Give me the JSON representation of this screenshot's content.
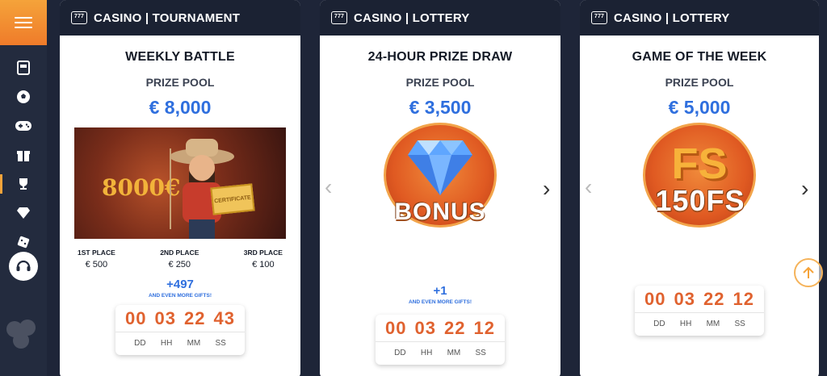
{
  "sidebar": {
    "icons": [
      "slot-machine-icon",
      "football-icon",
      "gamepad-icon",
      "gift-icon",
      "trophy-icon",
      "diamond-icon",
      "dice-icon"
    ],
    "active_index": 4,
    "support_icon": "headset-icon"
  },
  "colors": {
    "accent": "#f5a33a",
    "blue": "#2f6fde",
    "timer": "#e0622f",
    "dark": "#1b2233"
  },
  "cards": [
    {
      "header": "CASINO | TOURNAMENT",
      "title": "WEEKLY BATTLE",
      "pool_label": "PRIZE POOL",
      "pool_value": "€ 8,000",
      "banner_text": "8000€",
      "certificate_text": "CERTIFICATE",
      "places": [
        {
          "label": "1ST PLACE",
          "value": "€ 500"
        },
        {
          "label": "2ND PLACE",
          "value": "€ 250"
        },
        {
          "label": "3RD PLACE",
          "value": "€ 100"
        }
      ],
      "gifts": "+497",
      "gifts_sub": "AND EVEN MORE GIFTS!",
      "timer": {
        "dd": "00",
        "hh": "03",
        "mm": "22",
        "ss": "43"
      },
      "timer_units": [
        "DD",
        "HH",
        "MM",
        "SS"
      ]
    },
    {
      "header": "CASINO | LOTTERY",
      "title": "24-HOUR PRIZE DRAW",
      "pool_label": "PRIZE POOL",
      "pool_value": "€ 3,500",
      "badge_text": "BONUS",
      "gifts": "+1",
      "gifts_sub": "AND EVEN MORE GIFTS!",
      "timer": {
        "dd": "00",
        "hh": "03",
        "mm": "22",
        "ss": "12"
      },
      "timer_units": [
        "DD",
        "HH",
        "MM",
        "SS"
      ]
    },
    {
      "header": "CASINO | LOTTERY",
      "title": "GAME OF THE WEEK",
      "pool_label": "PRIZE POOL",
      "pool_value": "€ 5,000",
      "badge_text": "150FS",
      "badge_letters": "FS",
      "timer": {
        "dd": "00",
        "hh": "03",
        "mm": "22",
        "ss": "12"
      },
      "timer_units": [
        "DD",
        "HH",
        "MM",
        "SS"
      ]
    }
  ]
}
